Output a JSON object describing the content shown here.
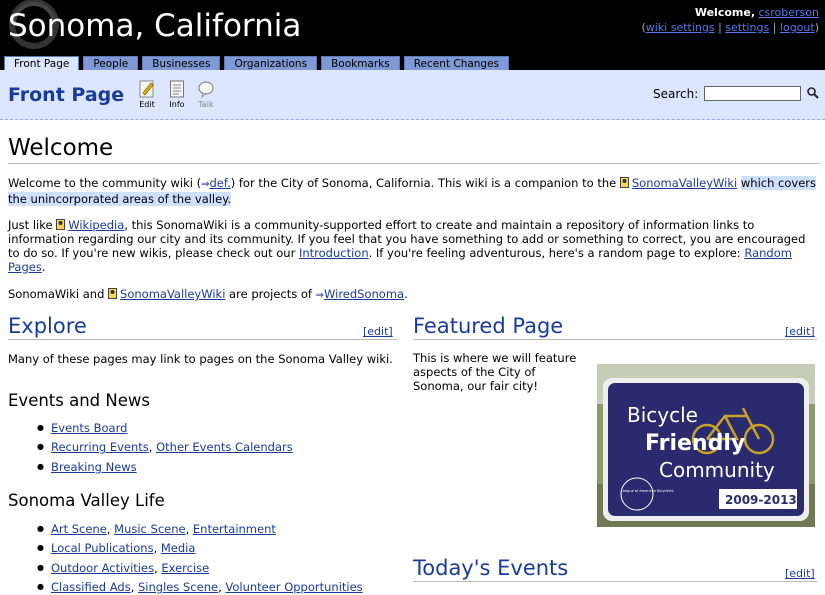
{
  "header": {
    "site_title": "Sonoma, California",
    "welcome": "Welcome,",
    "username": "csroberson",
    "links": [
      "wiki settings",
      "settings",
      "logout"
    ],
    "sep": "|",
    "open_paren": "(",
    "close_paren": ")"
  },
  "tabs": [
    "Front Page",
    "People",
    "Businesses",
    "Organizations",
    "Bookmarks",
    "Recent Changes"
  ],
  "title_bar": {
    "page_title": "Front Page",
    "actions": [
      "Edit",
      "Info",
      "Talk"
    ],
    "search_label": "Search:",
    "search_value": ""
  },
  "welcome": {
    "heading": "Welcome",
    "p1_a": "Welcome to the community wiki (",
    "p1_def": "def.",
    "p1_b": ") for the City of Sonoma, California. This wiki is a companion to the ",
    "p1_link": "SonomaValleyWiki",
    "p1_hl": "which covers the unincorporated areas of the valley.",
    "p2_a": "Just like ",
    "p2_wikipedia": "Wikipedia",
    "p2_b": ", this SonomaWiki is a community-supported effort to create and maintain a repository of information links to information regarding our city and its community. If you feel that you have something to add or something to correct, you are encouraged to do so. If you're new wikis, please check out our ",
    "p2_intro": "Introduction",
    "p2_c": ". If you're feeling adventurous, here's a random page to explore: ",
    "p2_random": "Random Pages",
    "p2_d": ".",
    "p3_a": "SonomaWiki and ",
    "p3_link": "SonomaValleyWiki",
    "p3_b": " are projects of ",
    "p3_wired": "WiredSonoma",
    "p3_c": "."
  },
  "explore": {
    "heading": "Explore",
    "edit": "[edit]",
    "intro": "Many of these pages may link to pages on the Sonoma Valley wiki.",
    "events_heading": "Events and News",
    "events": [
      [
        "Events Board"
      ],
      [
        "Recurring Events",
        "Other Events Calendars"
      ],
      [
        "Breaking News"
      ]
    ],
    "life_heading": "Sonoma Valley Life",
    "life": [
      [
        "Art Scene",
        "Music Scene",
        "Entertainment"
      ],
      [
        "Local Publications",
        "Media"
      ],
      [
        "Outdoor Activities",
        "Exercise"
      ],
      [
        "Classified Ads",
        "Singles Scene",
        "Volunteer Opportunities"
      ]
    ]
  },
  "featured": {
    "heading": "Featured Page",
    "edit": "[edit]",
    "text": "This is where we will feature aspects of the City of Sonoma, our fair city!",
    "sign": {
      "line1": "Bicycle",
      "line2": "Friendly",
      "line3": "Community",
      "years": "2009-2013",
      "badge": "League of American Bicyclists"
    }
  },
  "today": {
    "heading": "Today's Events",
    "edit": "[edit]"
  },
  "colors": {
    "header_bg": "#000000",
    "tab": "#7f99d6",
    "titlebar": "#dde6ff",
    "link": "#1a3a9c",
    "highlight": "#cfe0ff"
  }
}
